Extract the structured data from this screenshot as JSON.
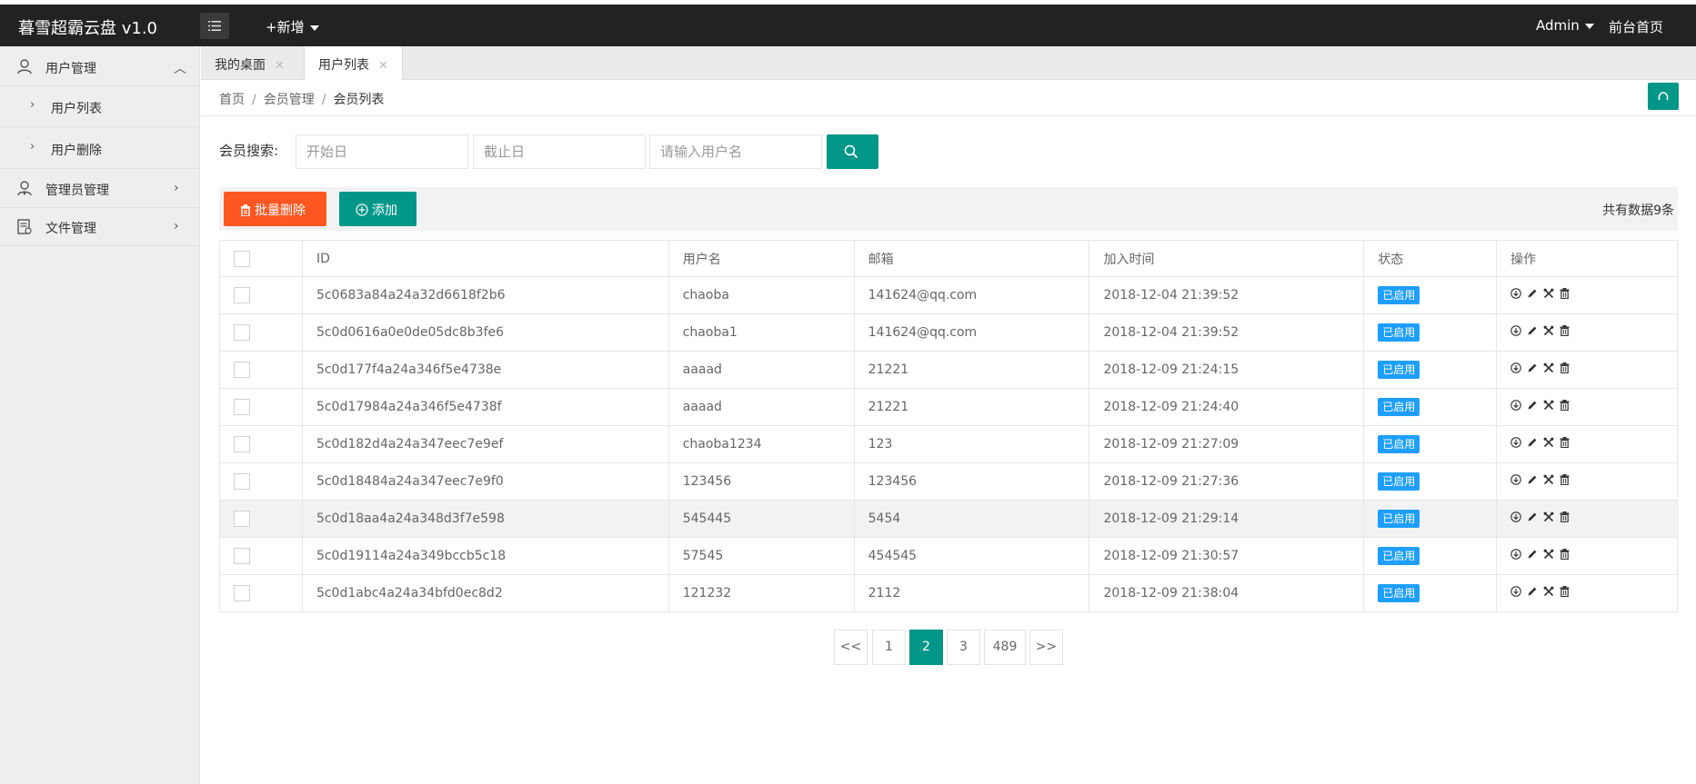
{
  "header": {
    "app_title": "暮雪超霸云盘 v1.0",
    "add_new": "+新增",
    "admin_label": "Admin",
    "front_page": "前台首页"
  },
  "sidebar": {
    "user_mgmt": "用户管理",
    "user_list": "用户列表",
    "user_delete": "用户删除",
    "admin_mgmt": "管理员管理",
    "file_mgmt": "文件管理"
  },
  "tabs": [
    {
      "label": "我的桌面",
      "close": "✕"
    },
    {
      "label": "用户列表",
      "close": "✕"
    }
  ],
  "breadcrumb": {
    "home": "首页",
    "members": "会员管理",
    "current": "会员列表",
    "sep": "/"
  },
  "search": {
    "label": "会员搜索:",
    "start_placeholder": "开始日",
    "end_placeholder": "截止日",
    "username_placeholder": "请输入用户名"
  },
  "toolbar": {
    "batch_delete": "批量删除",
    "add": "添加",
    "total": "共有数据9条"
  },
  "table": {
    "headers": [
      "ID",
      "用户名",
      "邮箱",
      "加入时间",
      "状态",
      "操作"
    ],
    "status_label": "已启用",
    "rows": [
      {
        "id": "5c0683a84a24a32d6618f2b6",
        "username": "chaoba",
        "email": "141624@qq.com",
        "joined": "2018-12-04 21:39:52"
      },
      {
        "id": "5c0d0616a0e0de05dc8b3fe6",
        "username": "chaoba1",
        "email": "141624@qq.com",
        "joined": "2018-12-04 21:39:52"
      },
      {
        "id": "5c0d177f4a24a346f5e4738e",
        "username": "aaaad",
        "email": "21221",
        "joined": "2018-12-09 21:24:15"
      },
      {
        "id": "5c0d17984a24a346f5e4738f",
        "username": "aaaad",
        "email": "21221",
        "joined": "2018-12-09 21:24:40"
      },
      {
        "id": "5c0d182d4a24a347eec7e9ef",
        "username": "chaoba1234",
        "email": "123",
        "joined": "2018-12-09 21:27:09"
      },
      {
        "id": "5c0d18484a24a347eec7e9f0",
        "username": "123456",
        "email": "123456",
        "joined": "2018-12-09 21:27:36"
      },
      {
        "id": "5c0d18aa4a24a348d3f7e598",
        "username": "545445",
        "email": "5454",
        "joined": "2018-12-09 21:29:14"
      },
      {
        "id": "5c0d19114a24a349bccb5c18",
        "username": "57545",
        "email": "454545",
        "joined": "2018-12-09 21:30:57"
      },
      {
        "id": "5c0d1abc4a24a34bfd0ec8d2",
        "username": "121232",
        "email": "2112",
        "joined": "2018-12-09 21:38:04"
      }
    ]
  },
  "pagination": {
    "prev": "<<",
    "pages": [
      "1",
      "2",
      "3",
      "489"
    ],
    "current": "2",
    "next": ">>"
  },
  "colors": {
    "header_bg": "#222222",
    "accent": "#009688",
    "danger": "#ff5722",
    "status": "#1e9fff"
  }
}
